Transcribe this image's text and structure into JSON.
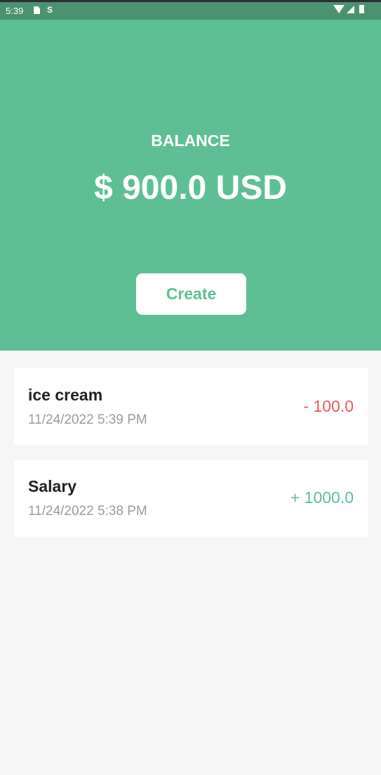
{
  "status_bar": {
    "time": "5:39",
    "left_icons": [
      "sd-card-icon",
      "s-icon"
    ],
    "right_icons": [
      "wifi-icon",
      "signal-icon",
      "battery-icon"
    ]
  },
  "header": {
    "balance_label": "BALANCE",
    "balance_amount": "$ 900.0 USD",
    "create_label": "Create",
    "background_color": "#5fbf94"
  },
  "transactions": [
    {
      "title": "ice cream",
      "date": "11/24/2022 5:39 PM",
      "amount": "- 100.0",
      "amount_color": "#e85a5a"
    },
    {
      "title": "Salary",
      "date": "11/24/2022 5:38 PM",
      "amount": "+ 1000.0",
      "amount_color": "#5fbf94"
    }
  ]
}
